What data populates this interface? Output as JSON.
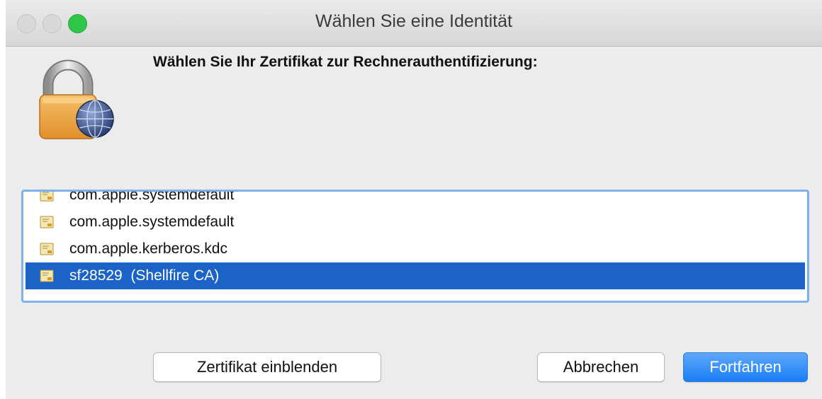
{
  "window": {
    "title": "Wählen Sie eine Identität"
  },
  "dialog": {
    "headline": "Wählen Sie Ihr Zertifikat zur Rechnerauthentifizierung:",
    "icon": "lock-network-icon"
  },
  "certificates": [
    {
      "label": "com.apple.systemdefault",
      "selected": false,
      "icon": "certificate-icon"
    },
    {
      "label": "com.apple.systemdefault",
      "selected": false,
      "icon": "certificate-icon"
    },
    {
      "label": "com.apple.kerberos.kdc",
      "selected": false,
      "icon": "certificate-icon"
    },
    {
      "label": "sf28529  (Shellfire CA)",
      "selected": true,
      "icon": "certificate-icon"
    }
  ],
  "buttons": {
    "show_certificate": "Zertifikat einblenden",
    "cancel": "Abbrechen",
    "continue": "Fortfahren"
  },
  "colors": {
    "selection": "#1b63c6",
    "focus_ring": "#7db0ee",
    "default_button": "#1a7ef5",
    "zoom_button": "#2fc548"
  }
}
